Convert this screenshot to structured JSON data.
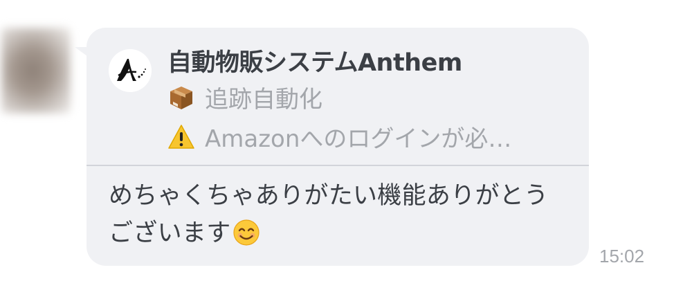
{
  "message": {
    "sender_avatar": "blurred-avatar",
    "preview_card": {
      "logo_icon": "anthem-logo-icon",
      "title": "自動物販システムAnthem",
      "line1_icon": "package-icon",
      "line1_text": "追跡自動化",
      "line2_icon": "warning-icon",
      "line2_text": "Amazonへのログインが必…"
    },
    "body_text": "めちゃくちゃありがたい機能ありがとうございます",
    "body_emoji": "smiling-face-icon",
    "timestamp": "15:02"
  },
  "colors": {
    "bubble_background": "#f0f1f4",
    "primary_text": "#3b3f45",
    "secondary_text": "#a3a6ab",
    "divider": "#d2d4d9"
  }
}
